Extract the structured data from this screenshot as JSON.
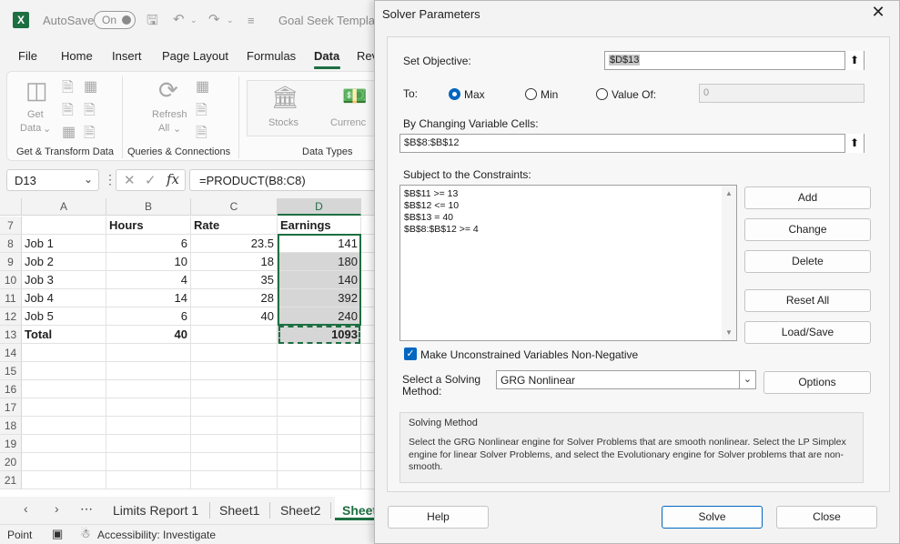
{
  "excel": {
    "title_bar": {
      "autosave_label": "AutoSave",
      "autosave_state": "On",
      "document_title": "Goal Seek Template..."
    },
    "ribbon_tabs": [
      "File",
      "Home",
      "Insert",
      "Page Layout",
      "Formulas",
      "Data",
      "Rev"
    ],
    "active_tab": "Data",
    "ribbon": {
      "get_data": "Get",
      "get_data_line2": "Data",
      "refresh": "Refresh",
      "refresh_line2": "All",
      "stocks": "Stocks",
      "currencies": "Currenc",
      "group_get_transform": "Get & Transform Data",
      "group_queries": "Queries & Connections",
      "group_data_types": "Data Types"
    },
    "name_box": "D13",
    "formula": "=PRODUCT(B8:C8)",
    "columns": [
      "A",
      "B",
      "C",
      "D"
    ],
    "rows": [
      {
        "num": "7",
        "a": "",
        "b": "Hours",
        "c": "Rate",
        "d": "Earnings"
      },
      {
        "num": "8",
        "a": "Job 1",
        "b": "6",
        "c": "23.5",
        "d": "141"
      },
      {
        "num": "9",
        "a": "Job 2",
        "b": "10",
        "c": "18",
        "d": "180"
      },
      {
        "num": "10",
        "a": "Job 3",
        "b": "4",
        "c": "35",
        "d": "140"
      },
      {
        "num": "11",
        "a": "Job 4",
        "b": "14",
        "c": "28",
        "d": "392"
      },
      {
        "num": "12",
        "a": "Job 5",
        "b": "6",
        "c": "40",
        "d": "240"
      },
      {
        "num": "13",
        "a": "Total",
        "b": "40",
        "c": "",
        "d": "1093"
      },
      {
        "num": "14"
      },
      {
        "num": "15"
      },
      {
        "num": "16"
      },
      {
        "num": "17"
      },
      {
        "num": "18"
      },
      {
        "num": "19"
      },
      {
        "num": "20"
      },
      {
        "num": "21"
      }
    ],
    "sheet_tabs": [
      "Limits Report 1",
      "Sheet1",
      "Sheet2",
      "Sheet"
    ],
    "active_sheet": "Sheet",
    "status": {
      "mode": "Point",
      "accessibility": "Accessibility: Investigate"
    }
  },
  "solver": {
    "title": "Solver Parameters",
    "set_objective_label": "Set Objective:",
    "objective_value": "$D$13",
    "to_label": "To:",
    "options": [
      "Max",
      "Min",
      "Value Of:"
    ],
    "selected_option": "Max",
    "value_of": "0",
    "changing_cells_label": "By Changing Variable Cells:",
    "changing_cells": "$B$8:$B$12",
    "constraints_label": "Subject to the Constraints:",
    "constraints": [
      "$B$11 >= 13",
      "$B$12 <= 10",
      "$B$13 = 40",
      "$B$8:$B$12 >= 4"
    ],
    "buttons": {
      "add": "Add",
      "change": "Change",
      "delete": "Delete",
      "reset_all": "Reset All",
      "load_save": "Load/Save",
      "options": "Options",
      "help": "Help",
      "solve": "Solve",
      "close": "Close"
    },
    "unconstrained_label": "Make Unconstrained Variables Non-Negative",
    "unconstrained_checked": true,
    "method_label_1": "Select a Solving",
    "method_label_2": "Method:",
    "method": "GRG Nonlinear",
    "method_group_title": "Solving Method",
    "method_description": "Select the GRG Nonlinear engine for Solver Problems that are smooth nonlinear. Select the LP Simplex engine for linear Solver Problems, and select the Evolutionary engine for Solver problems that are non-smooth."
  },
  "colors": {
    "excel_green": "#1d6f42",
    "accent_blue": "#0067c0",
    "selection_gray": "#d6d6d6"
  }
}
